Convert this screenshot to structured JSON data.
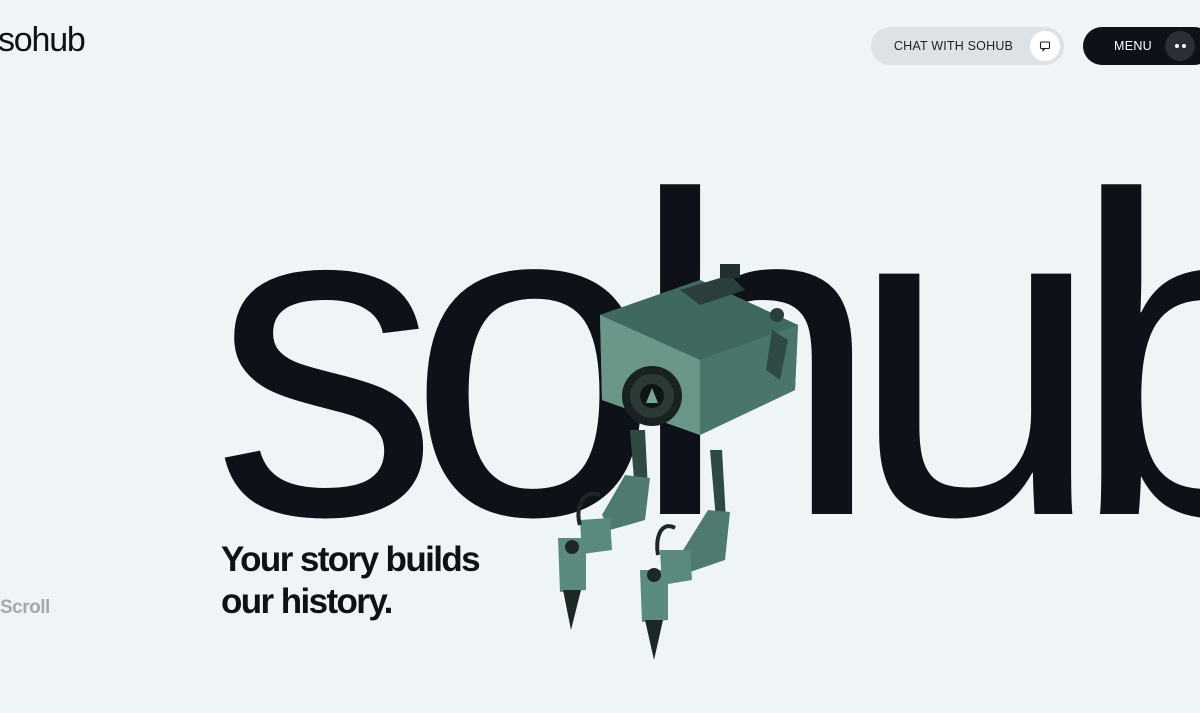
{
  "header": {
    "logo_text": "sohub",
    "chat_button_label": "CHAT WITH SOHUB",
    "chat_icon": "chat-bubble-icon",
    "menu_button_label": "MENU",
    "menu_icon": "dots-icon"
  },
  "hero": {
    "big_word": "sohub",
    "tagline_line1": "Your story builds",
    "tagline_line2": "our history.",
    "scroll_label": "Scroll",
    "image": "robot-illustration"
  },
  "colors": {
    "background": "#eff4f7",
    "text_dark": "#0e1117",
    "chat_button_bg": "#dde2e6",
    "menu_button_bg": "#0e1117",
    "scroll_text": "#a4a9ae",
    "robot_body": "#5e8a7f"
  }
}
